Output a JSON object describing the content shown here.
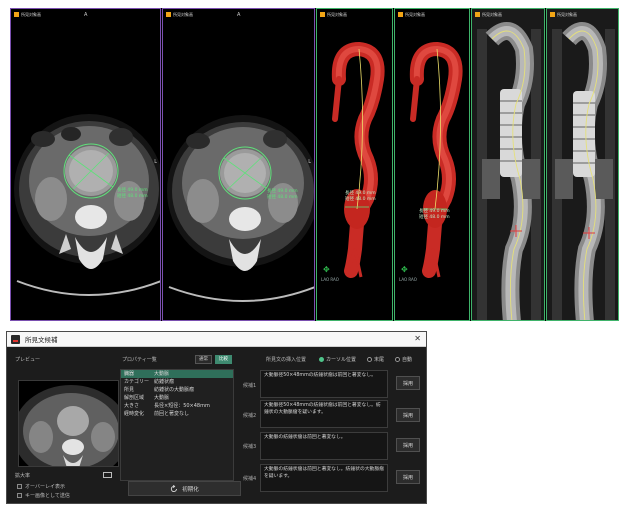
{
  "viewports": [
    {
      "header": "所見対象画",
      "top": "A",
      "right": "L"
    },
    {
      "header": "所見対象画",
      "top": "A",
      "right": "L"
    },
    {
      "header": "所見対象画",
      "measure": [
        "長径 49.0 mm",
        "短径 48.0 mm"
      ],
      "footer": "LAO RAO"
    },
    {
      "header": "所見対象画",
      "measure": [
        "長径 49.0 mm",
        "短径 48.0 mm"
      ],
      "footer": "LAO RAO"
    },
    {
      "header": "所見対象画"
    },
    {
      "header": "所見対象画"
    }
  ],
  "axial_measure": {
    "v1": [
      "長径 49.0 mm",
      "短径 48.0 mm"
    ],
    "v2": [
      "長径 49.0 mm",
      "短径 48.0 mm"
    ]
  },
  "dialog": {
    "title": "所見文候補",
    "close": "✕",
    "preview_label": "プレビュー",
    "zoom_label": "拡大率",
    "overlay_label": "オーバーレイ表示",
    "keyimage_label": "キー画像として送信",
    "props_label": "プロパティ一覧",
    "mode_buttons": [
      "通常",
      "比較"
    ],
    "properties": [
      {
        "k": "臓器",
        "v": "大動脈"
      },
      {
        "k": "カテゴリー",
        "v": "紡錘状瘤"
      },
      {
        "k": "所見",
        "v": "紡錘状の大動脈瘤"
      },
      {
        "k": "解剖区域",
        "v": "大動脈"
      },
      {
        "k": "大きさ",
        "v": "長径×短径：50×48mm"
      },
      {
        "k": "経時変化",
        "v": "前回と著変なし"
      }
    ],
    "init_button": "初期化",
    "insert_label": "所見文の挿入位置",
    "radios": [
      {
        "label": "カーソル位置",
        "on": true
      },
      {
        "label": "末尾",
        "on": false
      },
      {
        "label": "自動",
        "on": false
      }
    ],
    "candidates": [
      {
        "label": "候補1",
        "text": "大動脈径50×48mmの紡錘状瘤は前回と著変なし。",
        "button": "採用"
      },
      {
        "label": "候補2",
        "text": "大動脈径50×48mmの紡錘状瘤は前回と著変なし。紡錘状の大動脈瘤を疑います。",
        "button": "採用"
      },
      {
        "label": "候補3",
        "text": "大動脈の紡錘状瘤は前回と著変なし。",
        "button": "採用"
      },
      {
        "label": "候補4",
        "text": "大動脈の紡錘状瘤は前回と著変なし。紡錘状の大動脈瘤を疑います。",
        "button": "採用"
      }
    ]
  },
  "colors": {
    "axial_border": "#7a4fb0",
    "render_border": "#3fb36a",
    "aorta": "#d8322c",
    "measure": "#5fe07a",
    "accent": "#3e8a70"
  }
}
